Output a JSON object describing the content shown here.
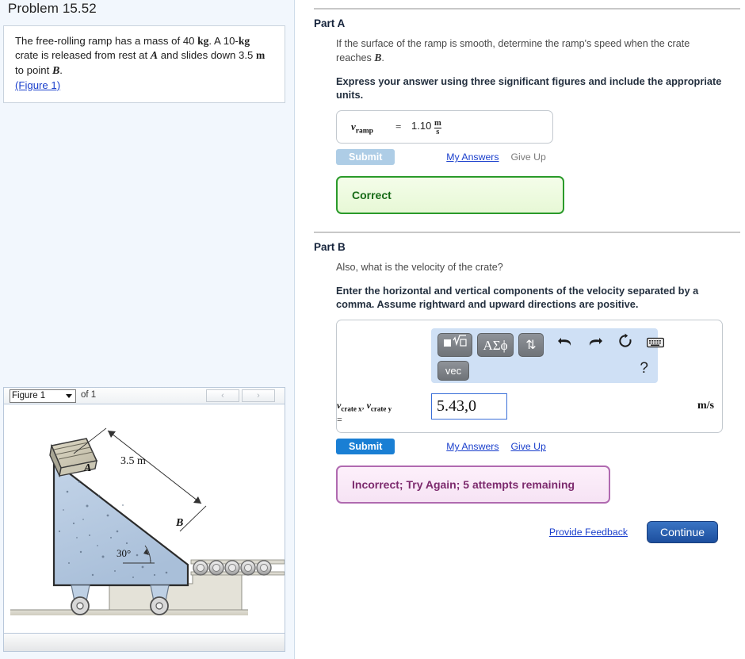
{
  "problem": {
    "title": "Problem 15.52",
    "statement_line1": "The free-rolling ramp has a mass of 40 ",
    "statement_kg1": "kg",
    "statement_line2": ". A 10-",
    "statement_kg2": "kg",
    "statement_line3": "crate is released from rest at ",
    "statement_A": "A",
    "statement_line4": " and slides down 3.5 ",
    "statement_m": "m",
    "statement_line5": "to point ",
    "statement_B": "B",
    "statement_period": ".",
    "figure_link": "(Figure 1)"
  },
  "figure_panel": {
    "selected": "Figure 1",
    "of_count": "of 1",
    "prev_icon": "chevron-left-icon",
    "next_icon": "chevron-right-icon",
    "prev_glyph": "‹",
    "next_glyph": "›",
    "labels": {
      "distance": "3.5 m",
      "point_a": "A",
      "point_b": "B",
      "angle": "30°"
    }
  },
  "part_a": {
    "heading": "Part A",
    "question": "If the surface of the ramp is smooth, determine the ramp's speed when the crate reaches ",
    "question_var": "B",
    "question_end": ".",
    "instruction": "Express your answer using three significant figures and include the appropriate units.",
    "answer": {
      "symbol": "v",
      "subscript": "ramp",
      "equals": "=",
      "value": "1.10",
      "unit_num": "m",
      "unit_den": "s"
    },
    "submit_label": "Submit",
    "my_answers_label": "My Answers",
    "give_up_label": "Give Up",
    "feedback": "Correct"
  },
  "part_b": {
    "heading": "Part B",
    "question": "Also, what is the velocity of the crate?",
    "instruction": "Enter the horizontal and vertical components of the velocity separated by a comma. Assume rightward and upward directions are positive.",
    "toolbar": {
      "template_btn": "template-math-icon",
      "greek_btn": "ΑΣϕ",
      "updown_btn": "⇅",
      "vec_btn": "vec",
      "undo_icon": "undo-icon",
      "redo_icon": "redo-icon",
      "reset_icon": "reset-icon",
      "keyboard_icon": "keyboard-icon",
      "help_glyph": "?",
      "bg_color": "#cfe0f5"
    },
    "answer": {
      "label_v1": "v",
      "label_sub1": "crate x",
      "comma": ",",
      "label_v2": "v",
      "label_sub2": "crate y",
      "equals": "=",
      "value": "5.43,0",
      "unit": "m/s"
    },
    "submit_label": "Submit",
    "my_answers_label": "My Answers",
    "give_up_label": "Give Up",
    "feedback": "Incorrect; Try Again; 5 attempts remaining"
  },
  "footer": {
    "provide_feedback": "Provide Feedback",
    "continue_label": "Continue"
  },
  "colors": {
    "accent_blue": "#1a7fd4",
    "link_blue": "#1a3fcc",
    "correct_green": "#2a9a2a",
    "incorrect_purple": "#b06ab0",
    "panel_bg": "#f2f7fd"
  }
}
